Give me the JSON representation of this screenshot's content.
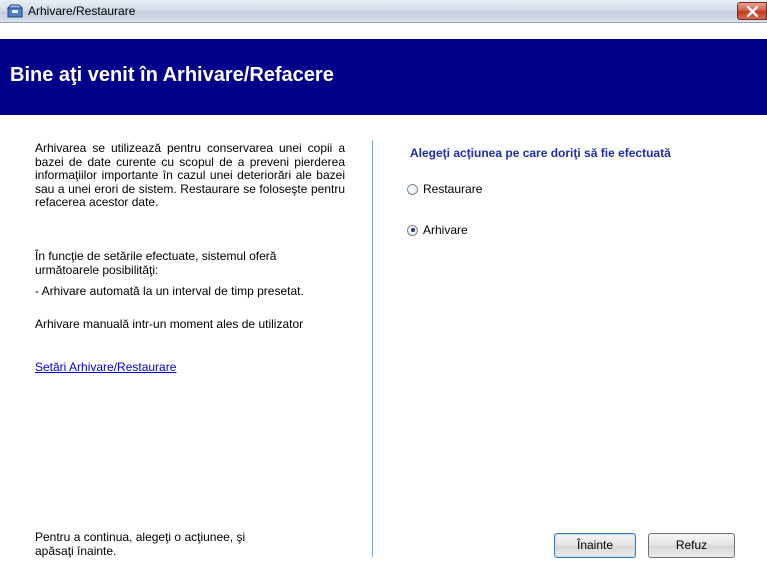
{
  "window": {
    "title": "Arhivare/Restaurare"
  },
  "banner": {
    "title": "Bine aţi venit în Arhivare/Refacere"
  },
  "left": {
    "description": "Arhivarea se utilizează pentru conservarea unei copii a bazei de date curente cu scopul de a preveni pierderea informaţiilor importante în cazul unei deteriorări ale bazei sau a unei erori de sistem. Restaurare se foloseşte pentru refacerea acestor date.",
    "options_intro_line1": "În funcţie de setările efectuate, sistemul oferă",
    "options_intro_line2": "următoarele posibilităţi:",
    "option_auto": "- Arhivare automată la un interval de timp presetat.",
    "option_manual": "Arhivare manuală intr-un moment ales de utilizator",
    "settings_link": "Setări Arhivare/Restaurare",
    "footer_line1": "Pentru a continua, alegeţi o acţiunee,  şi",
    "footer_line2": "apăsaţi înainte."
  },
  "right": {
    "heading": "Alegeţi acţiunea pe care doriţi să fie efectuată",
    "options": [
      {
        "label": "Restaurare",
        "checked": false
      },
      {
        "label": "Arhivare",
        "checked": true
      }
    ]
  },
  "buttons": {
    "next": "Înainte",
    "cancel": "Refuz"
  }
}
